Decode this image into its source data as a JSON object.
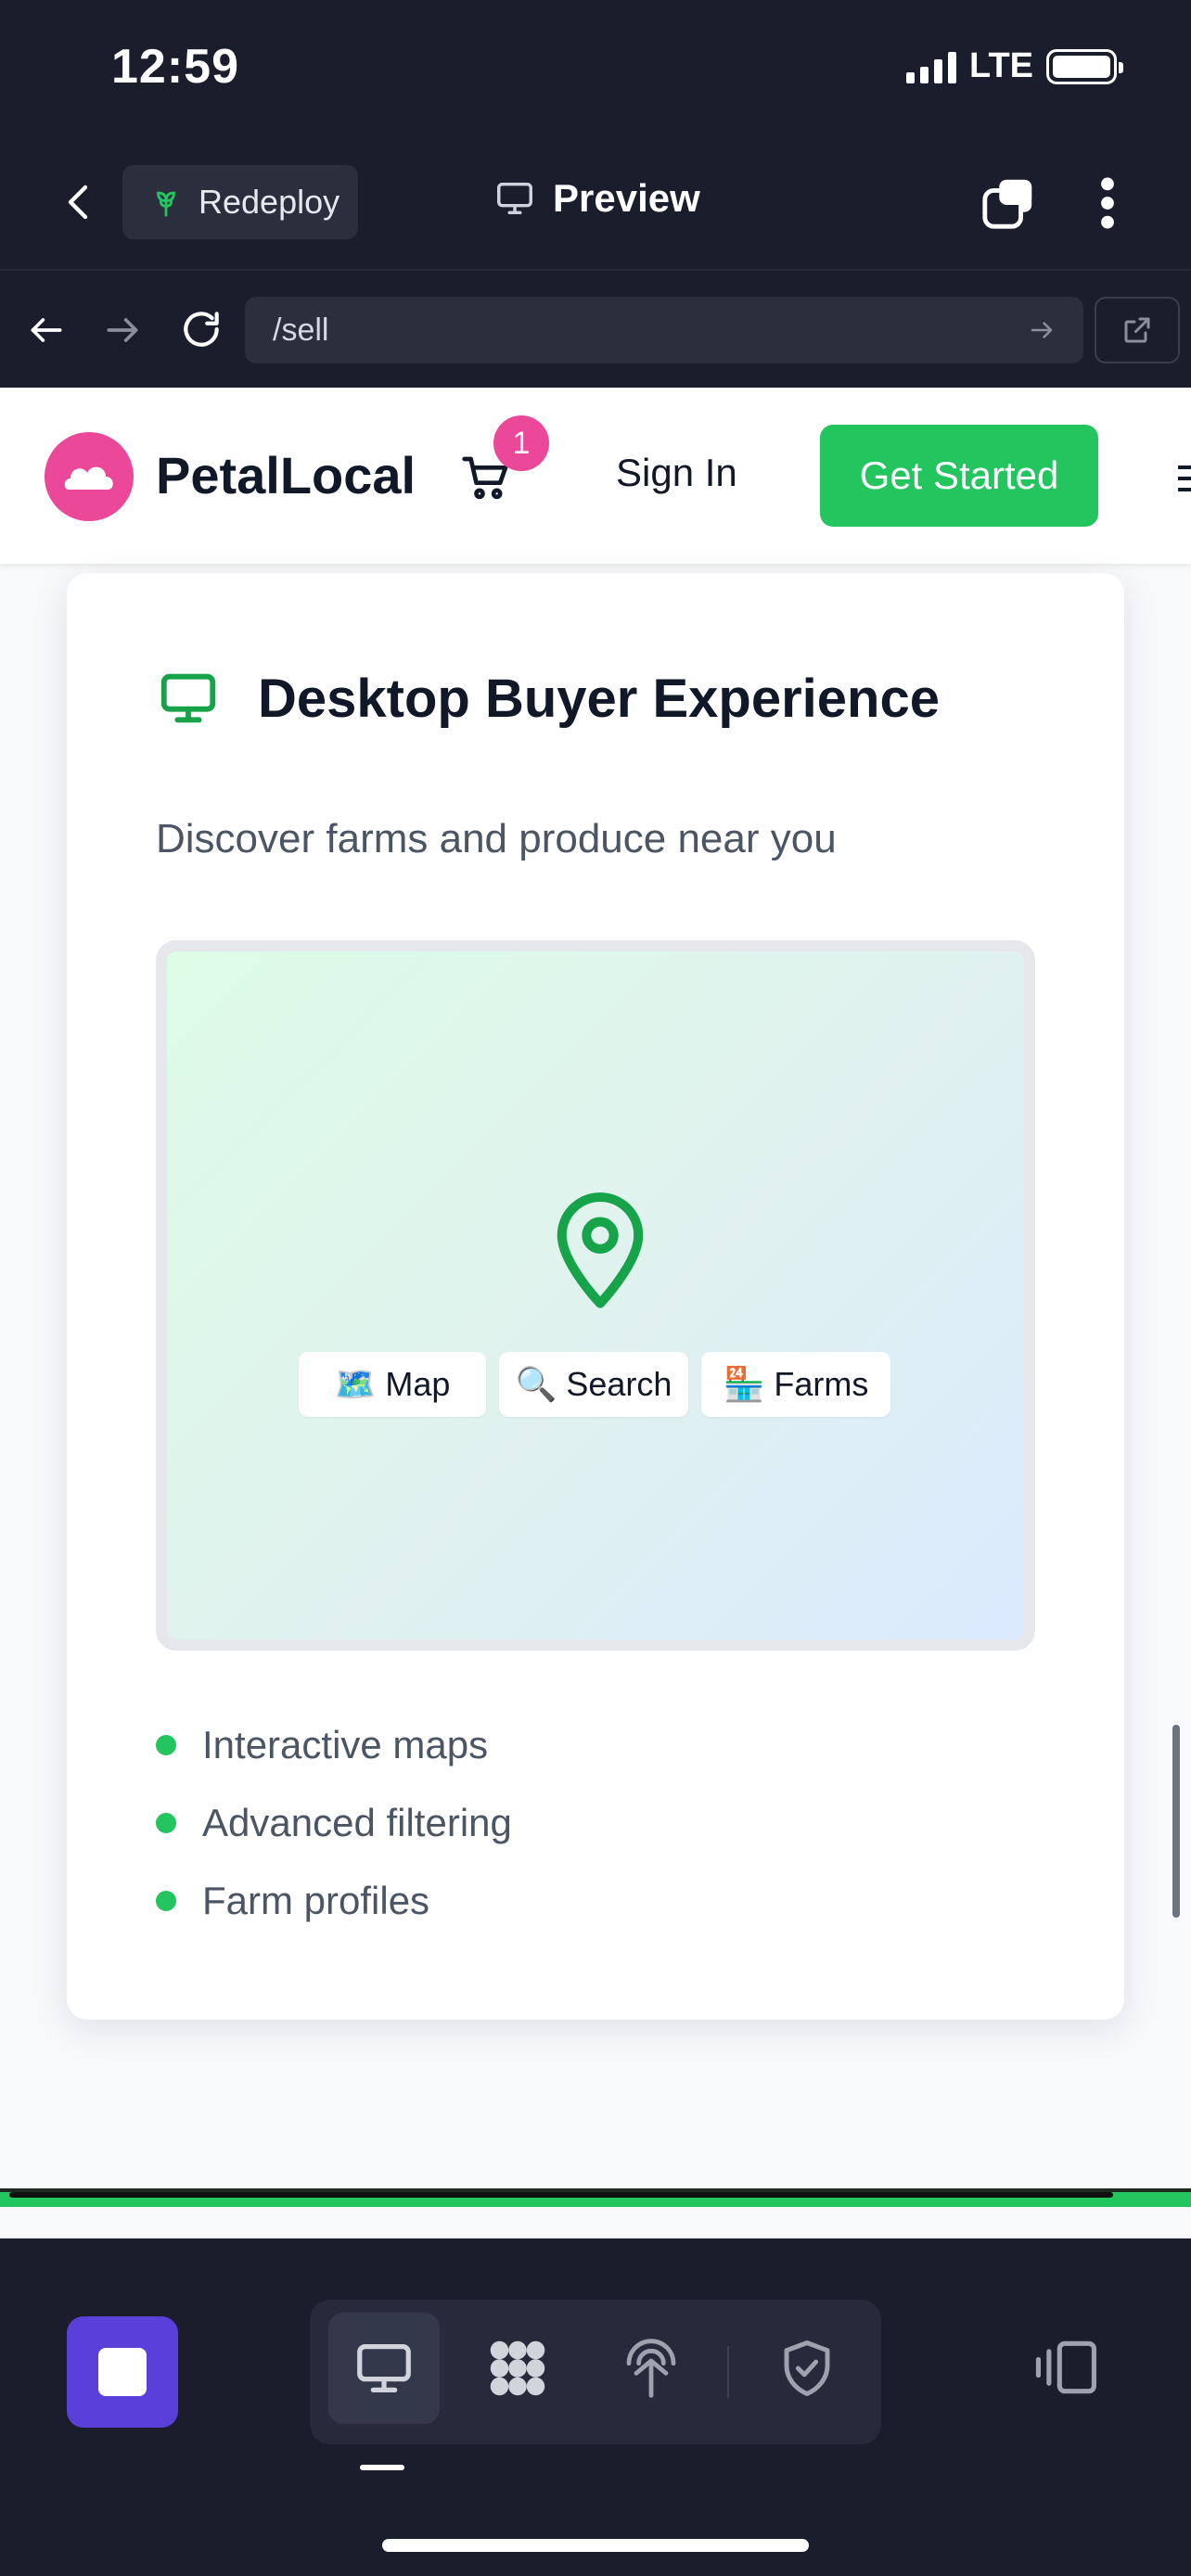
{
  "status_bar": {
    "time": "12:59",
    "network": "LTE"
  },
  "app_bar": {
    "redeploy_label": "Redeploy",
    "preview_label": "Preview"
  },
  "browser": {
    "url": "/sell"
  },
  "site": {
    "brand": "PetalLocal",
    "cart_count": "1",
    "sign_in": "Sign In",
    "get_started": "Get Started"
  },
  "card": {
    "title": "Desktop Buyer Experience",
    "subtitle": "Discover farms and produce near you",
    "pills": [
      {
        "icon": "🗺️",
        "label": "Map"
      },
      {
        "icon": "🔍",
        "label": "Search"
      },
      {
        "icon": "🏪",
        "label": "Farms"
      }
    ],
    "features": [
      "Interactive maps",
      "Advanced filtering",
      "Farm profiles"
    ]
  },
  "colors": {
    "accent_green": "#22c55e",
    "brand_pink": "#ec4899",
    "stop_purple": "#5b3fd9",
    "dark_bg": "#1a1d2b"
  },
  "icons": [
    "back-icon",
    "sprout-icon",
    "monitor-icon",
    "tabs-icon",
    "more-vertical-icon",
    "arrow-left-icon",
    "arrow-right-icon",
    "reload-icon",
    "external-link-icon",
    "cart-icon",
    "map-pin-icon",
    "stop-icon",
    "dots-grid-icon",
    "radar-icon",
    "shield-check-icon",
    "side-panel-icon"
  ]
}
